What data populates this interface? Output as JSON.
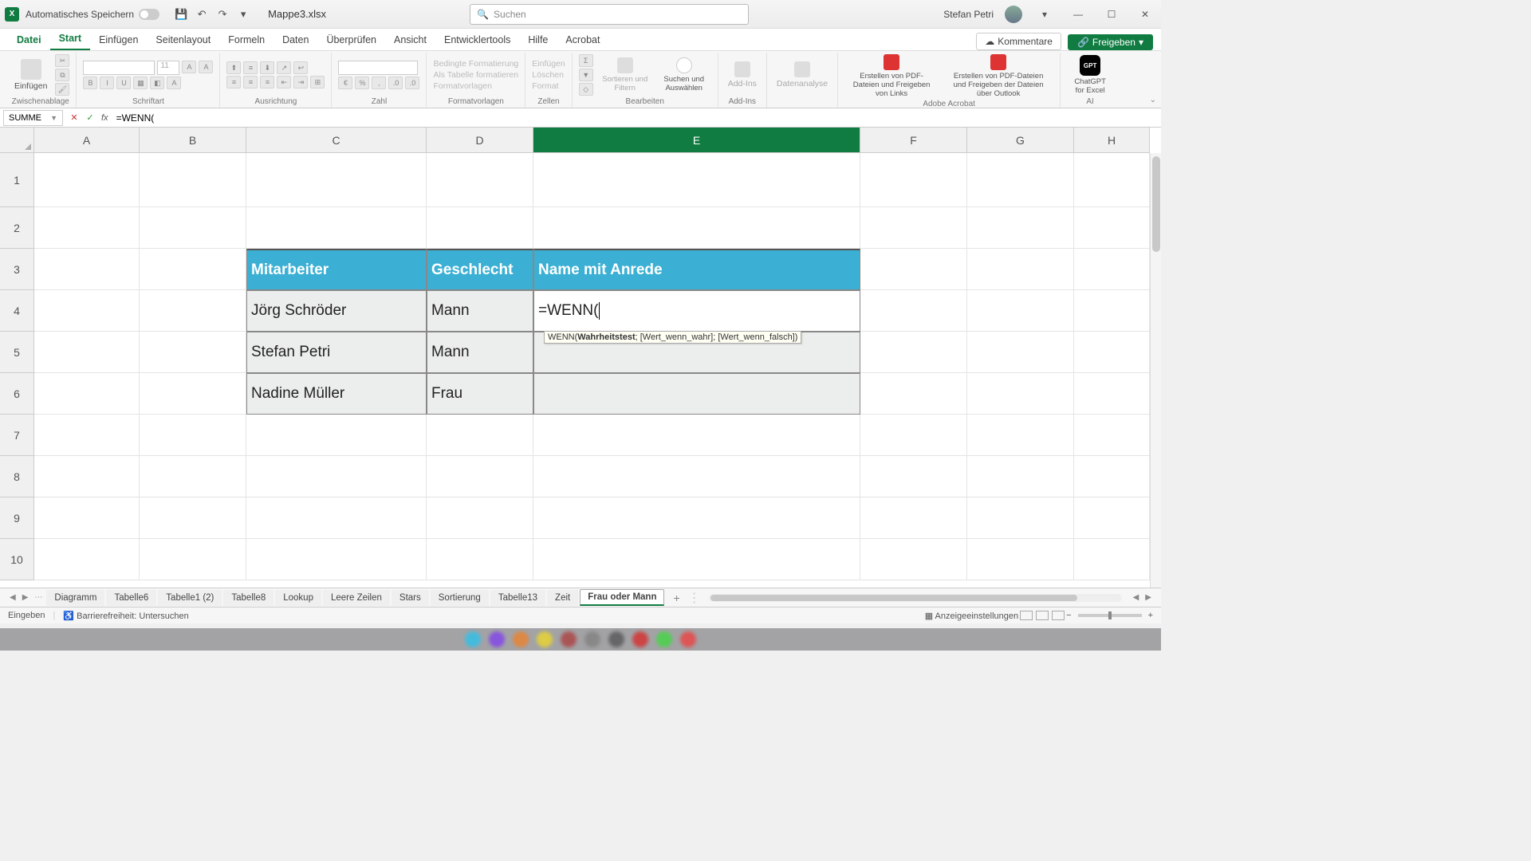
{
  "titlebar": {
    "autosave_label": "Automatisches Speichern",
    "doc_name": "Mappe3.xlsx",
    "search_placeholder": "Suchen",
    "user_name": "Stefan Petri"
  },
  "ribbon_tabs": {
    "file": "Datei",
    "home": "Start",
    "insert": "Einfügen",
    "pagelayout": "Seitenlayout",
    "formulas": "Formeln",
    "data": "Daten",
    "review": "Überprüfen",
    "view": "Ansicht",
    "developer": "Entwicklertools",
    "help": "Hilfe",
    "acrobat": "Acrobat",
    "comments": "Kommentare",
    "share": "Freigeben"
  },
  "ribbon": {
    "paste": "Einfügen",
    "clipboard": "Zwischenablage",
    "font_group": "Schriftart",
    "font_size": "11",
    "align": "Ausrichtung",
    "number": "Zahl",
    "cond_fmt": "Bedingte Formatierung",
    "as_table": "Als Tabelle formatieren",
    "cell_styles": "Formatvorlagen",
    "styles_group": "Formatvorlagen",
    "insert_cells": "Einfügen",
    "delete_cells": "Löschen",
    "format_cells": "Format",
    "cells_group": "Zellen",
    "sort_filter": "Sortieren und Filtern",
    "find_select": "Suchen und Auswählen",
    "editing": "Bearbeiten",
    "addins": "Add-Ins",
    "addins_group": "Add-Ins",
    "data_analysis": "Datenanalyse",
    "pdf_links": "Erstellen von PDF-Dateien und Freigeben von Links",
    "pdf_outlook": "Erstellen von PDF-Dateien und Freigeben der Dateien über Outlook",
    "adobe_group": "Adobe Acrobat",
    "chatgpt": "ChatGPT for Excel",
    "ai_group": "AI"
  },
  "formula_bar": {
    "name_box": "SUMME",
    "formula": "=WENN("
  },
  "columns": [
    "A",
    "B",
    "C",
    "D",
    "E",
    "F",
    "G",
    "H"
  ],
  "rows": [
    "1",
    "2",
    "3",
    "4",
    "5",
    "6",
    "7",
    "8",
    "9",
    "10"
  ],
  "table": {
    "h1": "Mitarbeiter",
    "h2": "Geschlecht",
    "h3": "Name mit Anrede",
    "r1c1": "Jörg Schröder",
    "r1c2": "Mann",
    "r1c3": "=WENN(",
    "r2c1": "Stefan Petri",
    "r2c2": "Mann",
    "r2c3": "",
    "r3c1": "Nadine Müller",
    "r3c2": "Frau",
    "r3c3": ""
  },
  "tooltip": {
    "fn": "WENN(",
    "arg_bold": "Wahrheitstest",
    "rest": "; [Wert_wenn_wahr]; [Wert_wenn_falsch])"
  },
  "sheets": {
    "s0": "Diagramm",
    "s1": "Tabelle6",
    "s2": "Tabelle1 (2)",
    "s3": "Tabelle8",
    "s4": "Lookup",
    "s5": "Leere Zeilen",
    "s6": "Stars",
    "s7": "Sortierung",
    "s8": "Tabelle13",
    "s9": "Zeit",
    "s10": "Frau oder Mann"
  },
  "status": {
    "mode": "Eingeben",
    "accessibility": "Barrierefreiheit: Untersuchen",
    "display_settings": "Anzeigeeinstellungen"
  }
}
